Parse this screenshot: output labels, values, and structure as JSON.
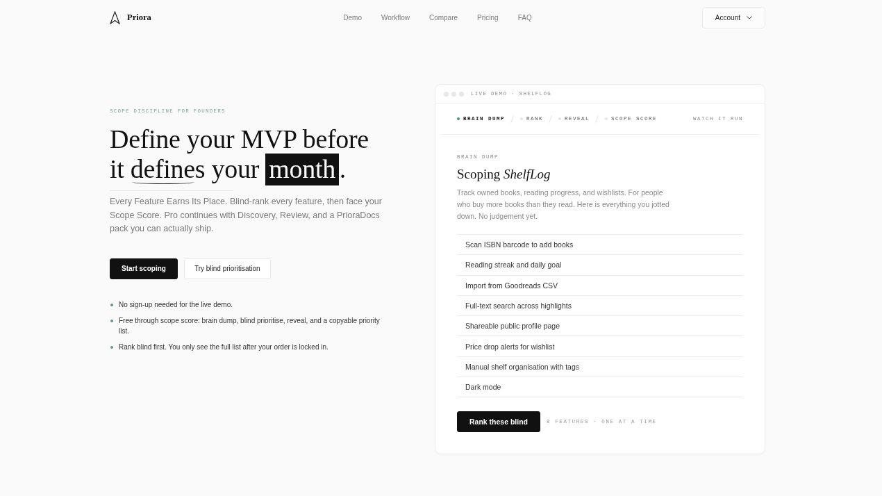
{
  "nav": {
    "brand": "Priora",
    "links": [
      "Demo",
      "Workflow",
      "Compare",
      "Pricing",
      "FAQ"
    ],
    "account": "Account"
  },
  "hero": {
    "eyebrow": "SCOPE DISCIPLINE FOR FOUNDERS",
    "headline": [
      {
        "text": "Define your MVP before it ",
        "kind": "plain"
      },
      {
        "text": "defines",
        "kind": "underline"
      },
      {
        "text": " your ",
        "kind": "plain"
      },
      {
        "text": "month",
        "kind": "highlight"
      },
      {
        "text": ".",
        "kind": "plain"
      }
    ],
    "lede": "Every Feature Earns Its Place. Blind-rank every feature, then face your Scope Score. Pro continues with Discovery, Review, and a PrioraDocs pack you can actually ship.",
    "buttons": [
      {
        "label": "Start scoping",
        "kind": "primary"
      },
      {
        "label": "Try blind prioritisation",
        "kind": "secondary"
      }
    ],
    "notes": [
      "No sign-up needed for the live demo.",
      "Free through scope score: brain dump, blind prioritise, reveal, and a copyable priority list.",
      "Rank blind first. You only see the full list after your order is locked in."
    ]
  },
  "demo": {
    "window_title": "LIVE DEMO · SHELFLOG",
    "steps": [
      {
        "label": "BRAIN DUMP",
        "selected": true
      },
      {
        "label": "RANK",
        "selected": false
      },
      {
        "label": "REVEAL",
        "selected": false
      },
      {
        "label": "SCOPE SCORE",
        "selected": false
      }
    ],
    "watch": "WATCH IT RUN",
    "section": "BRAIN DUMP",
    "title": "Scoping *ShelfLog*",
    "description": "Track owned books, reading progress, and wishlists. For people who buy more books than they read. Here is everything you jotted down. No judgement yet.",
    "features": [
      "Scan ISBN barcode to add books",
      "Reading streak and daily goal",
      "Import from Goodreads CSV",
      "Full-text search across highlights",
      "Shareable public profile page",
      "Price drop alerts for wishlist",
      "Manual shelf organisation with tags",
      "Dark mode"
    ],
    "button": "Rank these blind",
    "meta": "8 FEATURES · ONE AT A TIME"
  }
}
